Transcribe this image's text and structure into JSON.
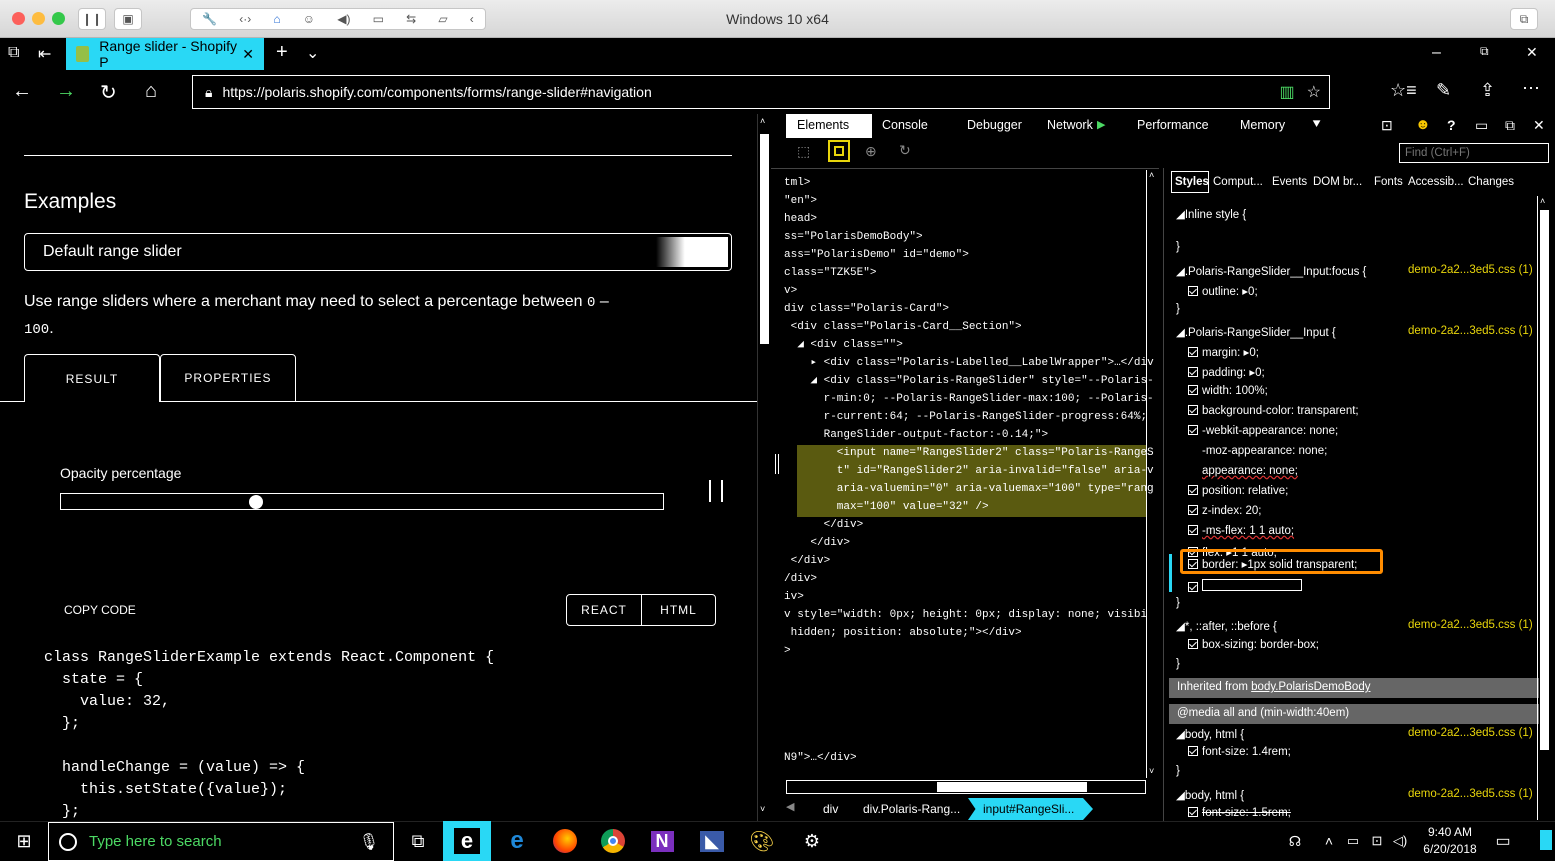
{
  "mac": {
    "window_title": "Windows 10 x64"
  },
  "browser": {
    "tab_title": "Range slider - Shopify P",
    "url": "https://polaris.shopify.com/components/forms/range-slider#navigation",
    "window_controls": [
      "minimize",
      "maximize",
      "close"
    ]
  },
  "page": {
    "section_title": "Examples",
    "example_select": "Default range slider",
    "description": "Use range sliders where a merchant may need to select a percentage between",
    "description_code1": "0",
    "description_dash": "–",
    "description_code2": "100",
    "description_end": ".",
    "tabs": [
      "RESULT",
      "PROPERTIES"
    ],
    "slider_label": "Opacity percentage",
    "slider_value": 32,
    "copy_code": "COPY CODE",
    "code_tabs": [
      "REACT",
      "HTML"
    ],
    "code_lines": [
      "class RangeSliderExample extends React.Component {",
      "  state = {",
      "    value: 32,",
      "  };",
      "",
      "  handleChange = (value) => {",
      "    this.setState({value});",
      "  };"
    ]
  },
  "devtools": {
    "tabs": [
      "Elements",
      "Console",
      "Debugger",
      "Network",
      "Performance",
      "Memory"
    ],
    "active_tab": "Elements",
    "find_placeholder": "Find (Ctrl+F)",
    "dom_lines": [
      "tml>",
      "\"en\">",
      "head>",
      "ss=\"PolarisDemoBody\">",
      "ass=\"PolarisDemo\" id=\"demo\">",
      "class=\"TZK5E\">",
      "v>",
      "div class=\"Polaris-Card\">",
      " <div class=\"Polaris-Card__Section\">",
      "  ◢ <div class=\"\">",
      "    ▸ <div class=\"Polaris-Labelled__LabelWrapper\">…</div",
      "    ◢ <div class=\"Polaris-RangeSlider\" style=\"--Polaris-",
      "      r-min:0; --Polaris-RangeSlider-max:100; --Polaris-",
      "      r-current:64; --Polaris-RangeSlider-progress:64%;",
      "      RangeSlider-output-factor:-0.14;\">",
      "        <input name=\"RangeSlider2\" class=\"Polaris-RangeS",
      "        t\" id=\"RangeSlider2\" aria-invalid=\"false\" aria-v",
      "        aria-valuemin=\"0\" aria-valuemax=\"100\" type=\"rang",
      "        max=\"100\" value=\"32\" />",
      "      </div>",
      "    </div>",
      " </div>",
      "/div>",
      "iv>",
      "v style=\"width: 0px; height: 0px; display: none; visibi",
      " hidden; position: absolute;\"></div>",
      ">"
    ],
    "dom_tail": "N9\">…</div>",
    "breadcrumbs": [
      "div",
      "div.Polaris-Rang...",
      "input#RangeSli..."
    ],
    "style_tabs": [
      "Styles",
      "Comput...",
      "Events",
      "DOM br...",
      "Fonts",
      "Accessib...",
      "Changes"
    ],
    "styles": {
      "inline_style": "◢Inline style  {",
      "close_brace": "}",
      "rule1_selector": "◢.Polaris-RangeSlider__Input:focus  {",
      "rule1_file": "demo-2a2...3ed5.css (1)",
      "rule1_props": [
        "outline:  ▸0;"
      ],
      "rule2_selector": "◢.Polaris-RangeSlider__Input  {",
      "rule2_file": "demo-2a2...3ed5.css (1)",
      "rule2_props": [
        "margin:  ▸0;",
        "padding:  ▸0;",
        "width:  100%;",
        "background-color:  transparent;",
        "-webkit-appearance:  none;",
        "-moz-appearance:  none;",
        "appearance:  none;",
        "position:  relative;",
        "z-index:  20;",
        "-ms-flex:  1 1 auto;",
        "flex:  ▸1 1 auto;"
      ],
      "border_prop": "border:  ▸1px solid transparent;",
      "rule3_selector": "◢*, ::after, ::before  {",
      "rule3_file": "demo-2a2...3ed5.css (1)",
      "rule3_props": [
        "box-sizing:  border-box;"
      ],
      "inherited_label": "Inherited from ",
      "inherited_link": "body.PolarisDemoBody",
      "media_label": "@media all and (min-width:40em)",
      "rule4_selector": "◢body, html  {",
      "rule4_file": "demo-2a2...3ed5.css (1)",
      "rule4_props": [
        "font-size:  1.4rem;"
      ],
      "rule5_selector": "◢body, html  {",
      "rule5_file": "demo-2a2...3ed5.css (1)",
      "rule5_props": [
        "font-size:  1.5rem;"
      ]
    }
  },
  "taskbar": {
    "search_placeholder": "Type here to search",
    "time": "9:40 AM",
    "date": "6/20/2018"
  },
  "colors": {
    "accent": "#29d8f5",
    "highlight": "#e8d50b",
    "focus_border": "#ff8c00"
  }
}
